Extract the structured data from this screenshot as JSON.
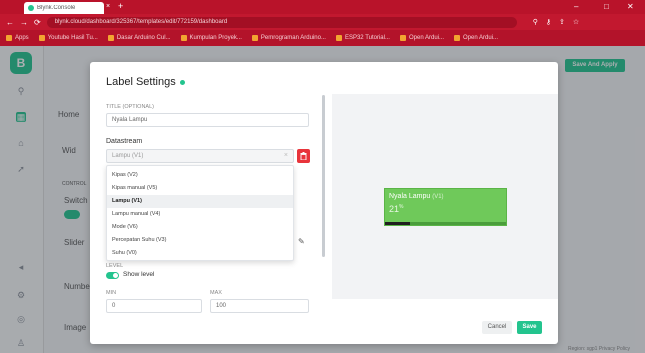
{
  "browser": {
    "tab_title": "Blynk.Console",
    "tab_close": "×",
    "new_tab": "+",
    "url": "blynk.cloud/dashboard/325367/templates/edit/772159/dashboard",
    "controls": {
      "minimize": "–",
      "maximize": "□",
      "close": "✕"
    },
    "bookmarks": [
      "Apps",
      "Youtube Hasil Tu...",
      "Dasar Arduino Cul...",
      "Kumpulan Proyek...",
      "Pemrograman Arduino...",
      "ESP32 Tutorial...",
      "Open Ardui...",
      "Open Ardui..."
    ]
  },
  "app": {
    "logo": "B",
    "home": "Home",
    "save_apply": "Save And Apply",
    "bg_labels": {
      "widget": "Wid",
      "control": "CONTROL",
      "switch": "Switch",
      "slider": "Slider",
      "number": "Numbe",
      "image": "Image"
    },
    "footer": "Region: sgp1  Privacy Policy"
  },
  "modal": {
    "title": "Label Settings",
    "title_field": {
      "label": "TITLE (OPTIONAL)",
      "value": "Nyala Lampu"
    },
    "datastream": {
      "label": "Datastream",
      "value": "Lampu (V1)",
      "clear": "×",
      "options": [
        {
          "label": "Kipas (V2)",
          "selected": false
        },
        {
          "label": "Kipas manual (V5)",
          "selected": false
        },
        {
          "label": "Lampu (V1)",
          "selected": true
        },
        {
          "label": "Lampu manual (V4)",
          "selected": false
        },
        {
          "label": "Mode (V6)",
          "selected": false
        },
        {
          "label": "Percepatan Suhu (V3)",
          "selected": false
        },
        {
          "label": "Suhu (V0)",
          "selected": false
        }
      ]
    },
    "level_section": "LEVEL",
    "show_level": "Show level",
    "min": {
      "label": "MIN",
      "value": "0"
    },
    "max": {
      "label": "MAX",
      "value": "100"
    },
    "preview": {
      "title": "Nyala Lampu",
      "pin": "(V1)",
      "value": "21",
      "unit": "%",
      "level": 0.21
    },
    "cancel": "Cancel",
    "save": "Save"
  },
  "colors": {
    "accent": "#23c48e",
    "browser": "#c2182f",
    "widget": "#6fc95a",
    "danger": "#e8343b"
  }
}
